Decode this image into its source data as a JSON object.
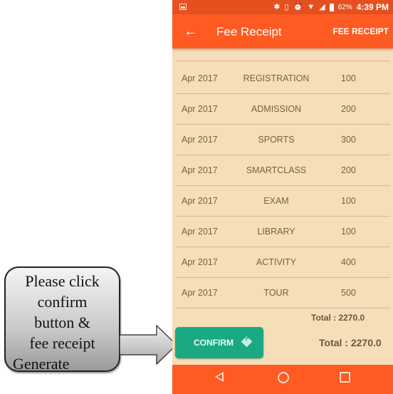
{
  "status_bar": {
    "icons": [
      "image-icon",
      "bluetooth-icon",
      "vibrate-icon",
      "alarm-icon",
      "wifi-icon",
      "signal-icon",
      "battery-icon"
    ],
    "battery": "62%",
    "time": "4:39 PM"
  },
  "app_bar": {
    "back_icon": "←",
    "title": "Fee Receipt",
    "action": "FEE RECEIPT"
  },
  "fee_rows": [
    {
      "month": "Apr 2017",
      "fee": "REGISTRATION",
      "amount": "100"
    },
    {
      "month": "Apr 2017",
      "fee": "ADMISSION",
      "amount": "200"
    },
    {
      "month": "Apr 2017",
      "fee": "SPORTS",
      "amount": "300"
    },
    {
      "month": "Apr 2017",
      "fee": "SMARTCLASS",
      "amount": "200"
    },
    {
      "month": "Apr 2017",
      "fee": "EXAM",
      "amount": "100"
    },
    {
      "month": "Apr 2017",
      "fee": "LIBRARY",
      "amount": "100"
    },
    {
      "month": "Apr 2017",
      "fee": "ACTIVITY",
      "amount": "400"
    },
    {
      "month": "Apr 2017",
      "fee": "TOUR",
      "amount": "500"
    }
  ],
  "list_total": "Total : 2270.0",
  "footer": {
    "confirm_label": "CONFIRM",
    "total": "Total : 2270.0"
  },
  "callout": {
    "lines": [
      "Please click",
      "confirm",
      "button &",
      "fee receipt",
      "Generate"
    ]
  },
  "colors": {
    "primary": "#fe5a22",
    "status_bar": "#e5501e",
    "background": "#f5deb8",
    "confirm": "#1aa982"
  }
}
